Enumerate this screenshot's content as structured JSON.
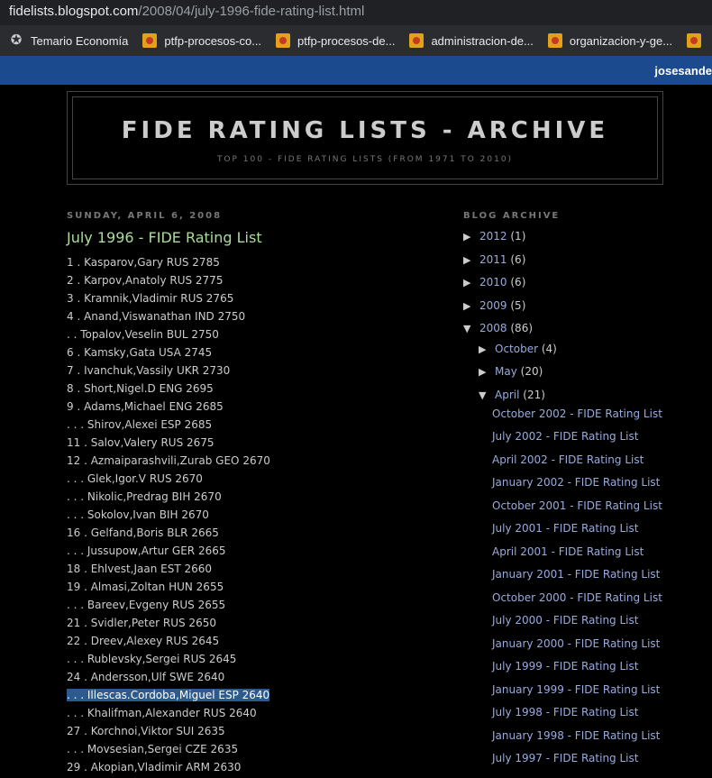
{
  "browser": {
    "url_host": "fidelists.blogspot.com",
    "url_path": "/2008/04/july-1996-fide-rating-list.html",
    "bookmarks": [
      {
        "label": "Temario Economía",
        "icon": "blogger-icon"
      },
      {
        "label": "ptfp-procesos-co...",
        "icon": "flag-icon"
      },
      {
        "label": "ptfp-procesos-de...",
        "icon": "flag-icon"
      },
      {
        "label": "administracion-de...",
        "icon": "flag-icon"
      },
      {
        "label": "organizacion-y-ge...",
        "icon": "flag-icon"
      }
    ],
    "navbar_user": "josesande"
  },
  "header": {
    "title": "FIDE RATING LISTS - ARCHIVE",
    "description": "TOP 100 - FIDE RATING LISTS (FROM 1971 TO 2010)"
  },
  "post": {
    "date": "SUNDAY, APRIL 6, 2008",
    "title": "July 1996 - FIDE Rating List",
    "entries": [
      "1 . Kasparov,Gary RUS 2785",
      "2 . Karpov,Anatoly RUS 2775",
      "3 . Kramnik,Vladimir RUS 2765",
      "4 . Anand,Viswanathan IND 2750",
      ". . Topalov,Veselin BUL 2750",
      "6 . Kamsky,Gata USA 2745",
      "7 . Ivanchuk,Vassily UKR 2730",
      "8 . Short,Nigel.D ENG 2695",
      "9 . Adams,Michael ENG 2685",
      ". . . Shirov,Alexei ESP 2685",
      "11 . Salov,Valery RUS 2675",
      "12 . Azmaiparashvili,Zurab GEO 2670",
      ". . . Glek,Igor.V RUS 2670",
      ". . . Nikolic,Predrag BIH 2670",
      ". . . Sokolov,Ivan BIH 2670",
      "16 . Gelfand,Boris BLR 2665",
      ". . . Jussupow,Artur GER 2665",
      "18 . Ehlvest,Jaan EST 2660",
      "19 . Almasi,Zoltan HUN 2655",
      ". . . Bareev,Evgeny RUS 2655",
      "21 . Svidler,Peter RUS 2650",
      "22 . Dreev,Alexey RUS 2645",
      ". . . Rublevsky,Sergei RUS 2645",
      "24 . Andersson,Ulf SWE 2640",
      ". . . Illescas.Cordoba,Miguel ESP 2640",
      ". . . Khalifman,Alexander RUS 2640",
      "27 . Korchnoi,Viktor SUI 2635",
      ". . . Movsesian,Sergei CZE 2635",
      "29 . Akopian,Vladimir ARM 2630"
    ]
  },
  "sidebar": {
    "heading": "BLOG ARCHIVE",
    "years": [
      {
        "label": "2012",
        "count": "(1)",
        "toggle": "▶"
      },
      {
        "label": "2011",
        "count": "(6)",
        "toggle": "▶"
      },
      {
        "label": "2010",
        "count": "(6)",
        "toggle": "▶"
      },
      {
        "label": "2009",
        "count": "(5)",
        "toggle": "▶"
      },
      {
        "label": "2008",
        "count": "(86)",
        "toggle": "▼"
      }
    ],
    "months": [
      {
        "label": "October",
        "count": "(4)",
        "toggle": "▶"
      },
      {
        "label": "May",
        "count": "(20)",
        "toggle": "▶"
      },
      {
        "label": "April",
        "count": "(21)",
        "toggle": "▼"
      }
    ],
    "posts": [
      "October 2002 - FIDE Rating List",
      "July 2002 - FIDE Rating List",
      "April 2002 - FIDE Rating List",
      "January 2002 - FIDE Rating List",
      "October 2001 - FIDE Rating List",
      "July 2001 - FIDE Rating List",
      "April 2001 - FIDE Rating List",
      "January 2001 - FIDE Rating List",
      "October 2000 - FIDE Rating List",
      "July 2000 - FIDE Rating List",
      "January 2000 - FIDE Rating List",
      "July 1999 - FIDE Rating List",
      "January 1999 - FIDE Rating List",
      "July 1998 - FIDE Rating List",
      "January 1998 - FIDE Rating List",
      "July 1997 - FIDE Rating List"
    ]
  }
}
